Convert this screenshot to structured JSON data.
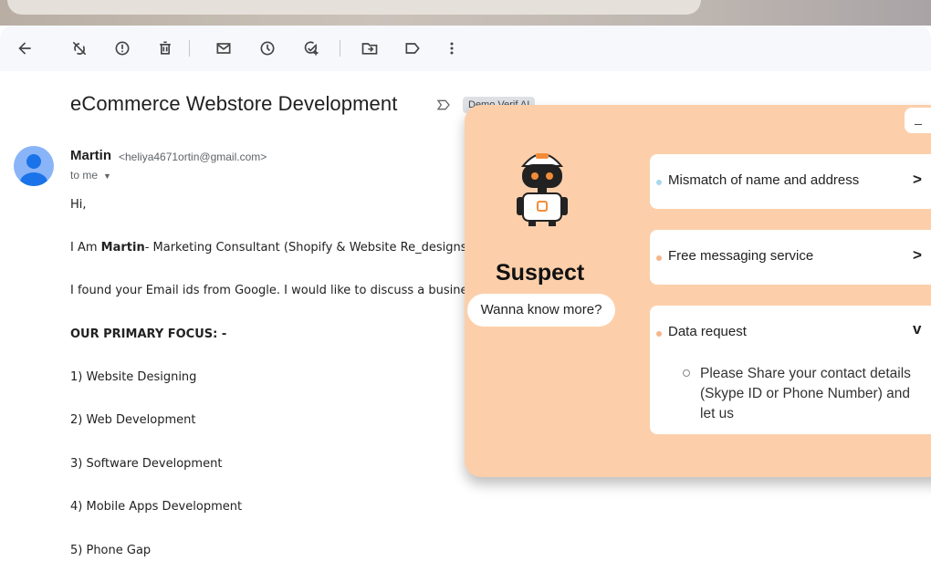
{
  "toolbar": {
    "icons": [
      "back-arrow-icon",
      "report-spam-icon",
      "info-icon",
      "delete-icon",
      "mark-unread-icon",
      "snooze-icon",
      "add-task-icon",
      "move-to-icon",
      "label-icon",
      "more-vert-icon"
    ]
  },
  "email": {
    "subject": "eCommerce Webstore Development",
    "label_chip": "Demo Verif AI",
    "sender_name": "Martin",
    "sender_email": "<heliya4671ortin@gmail.com>",
    "to_me": "to me",
    "greeting": "Hi,",
    "intro_prefix": "I Am ",
    "intro_bold": "Martin",
    "intro_rest": "- Marketing Consultant (Shopify & Website Re_designs)",
    "found": "I found your Email ids from Google. I would like to discuss a busines",
    "focus_heading": "OUR PRIMARY FOCUS: -",
    "focus_items": [
      "1) Website Designing",
      "2) Web Development",
      "3) Software Development",
      "4) Mobile Apps Development",
      "5) Phone Gap"
    ]
  },
  "panel": {
    "minimize_label": "_",
    "title": "Suspect",
    "more_button": "Wanna know more?",
    "cards": [
      {
        "title": "Mismatch of name and address",
        "chevron": ">",
        "dot_color": "#a7d8ee"
      },
      {
        "title": "Free messaging service",
        "chevron": ">",
        "dot_color": "#f5b48a"
      },
      {
        "title": "Data request",
        "chevron": "v",
        "dot_color": "#f5b48a",
        "detail": "Please Share your contact details (Skype ID or Phone Number) and let us"
      }
    ]
  },
  "colors": {
    "panel_bg": "#fccfaa",
    "avatar": "#8ab4f8",
    "toolbar_bg": "#f6f8fc"
  }
}
